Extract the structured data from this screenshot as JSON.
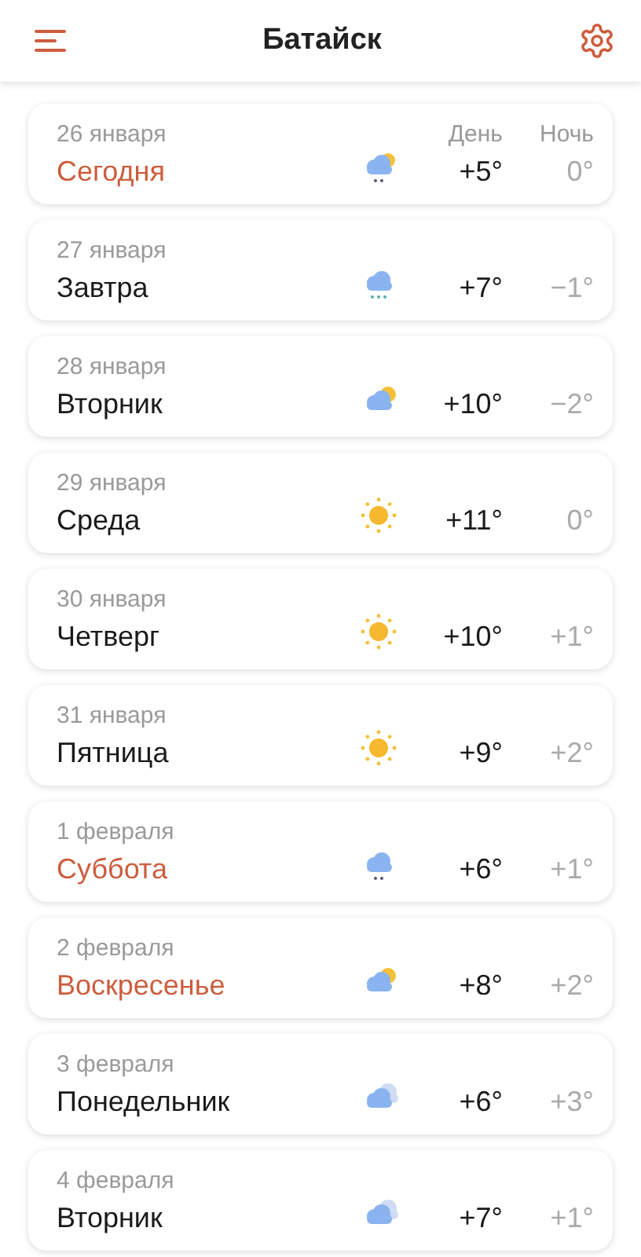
{
  "header": {
    "title": "Батайск"
  },
  "column_headers": {
    "day": "День",
    "night": "Ночь"
  },
  "days": [
    {
      "date": "26 января",
      "name": "Сегодня",
      "highlighted": true,
      "kind": "showers",
      "day": "+5°",
      "night": "0°"
    },
    {
      "date": "27 января",
      "name": "Завтра",
      "highlighted": false,
      "kind": "sleet",
      "day": "+7°",
      "night": "−1°"
    },
    {
      "date": "28 января",
      "name": "Вторник",
      "highlighted": false,
      "kind": "partly",
      "day": "+10°",
      "night": "−2°"
    },
    {
      "date": "29 января",
      "name": "Среда",
      "highlighted": false,
      "kind": "sunny",
      "day": "+11°",
      "night": "0°"
    },
    {
      "date": "30 января",
      "name": "Четверг",
      "highlighted": false,
      "kind": "sunny",
      "day": "+10°",
      "night": "+1°"
    },
    {
      "date": "31 января",
      "name": "Пятница",
      "highlighted": false,
      "kind": "sunny",
      "day": "+9°",
      "night": "+2°"
    },
    {
      "date": "1 февраля",
      "name": "Суббота",
      "highlighted": true,
      "kind": "rain",
      "day": "+6°",
      "night": "+1°"
    },
    {
      "date": "2 февраля",
      "name": "Воскресенье",
      "highlighted": true,
      "kind": "partly",
      "day": "+8°",
      "night": "+2°"
    },
    {
      "date": "3 февраля",
      "name": "Понедельник",
      "highlighted": false,
      "kind": "cloudy",
      "day": "+6°",
      "night": "+3°"
    },
    {
      "date": "4 февраля",
      "name": "Вторник",
      "highlighted": false,
      "kind": "cloudy",
      "day": "+7°",
      "night": "+1°"
    }
  ]
}
